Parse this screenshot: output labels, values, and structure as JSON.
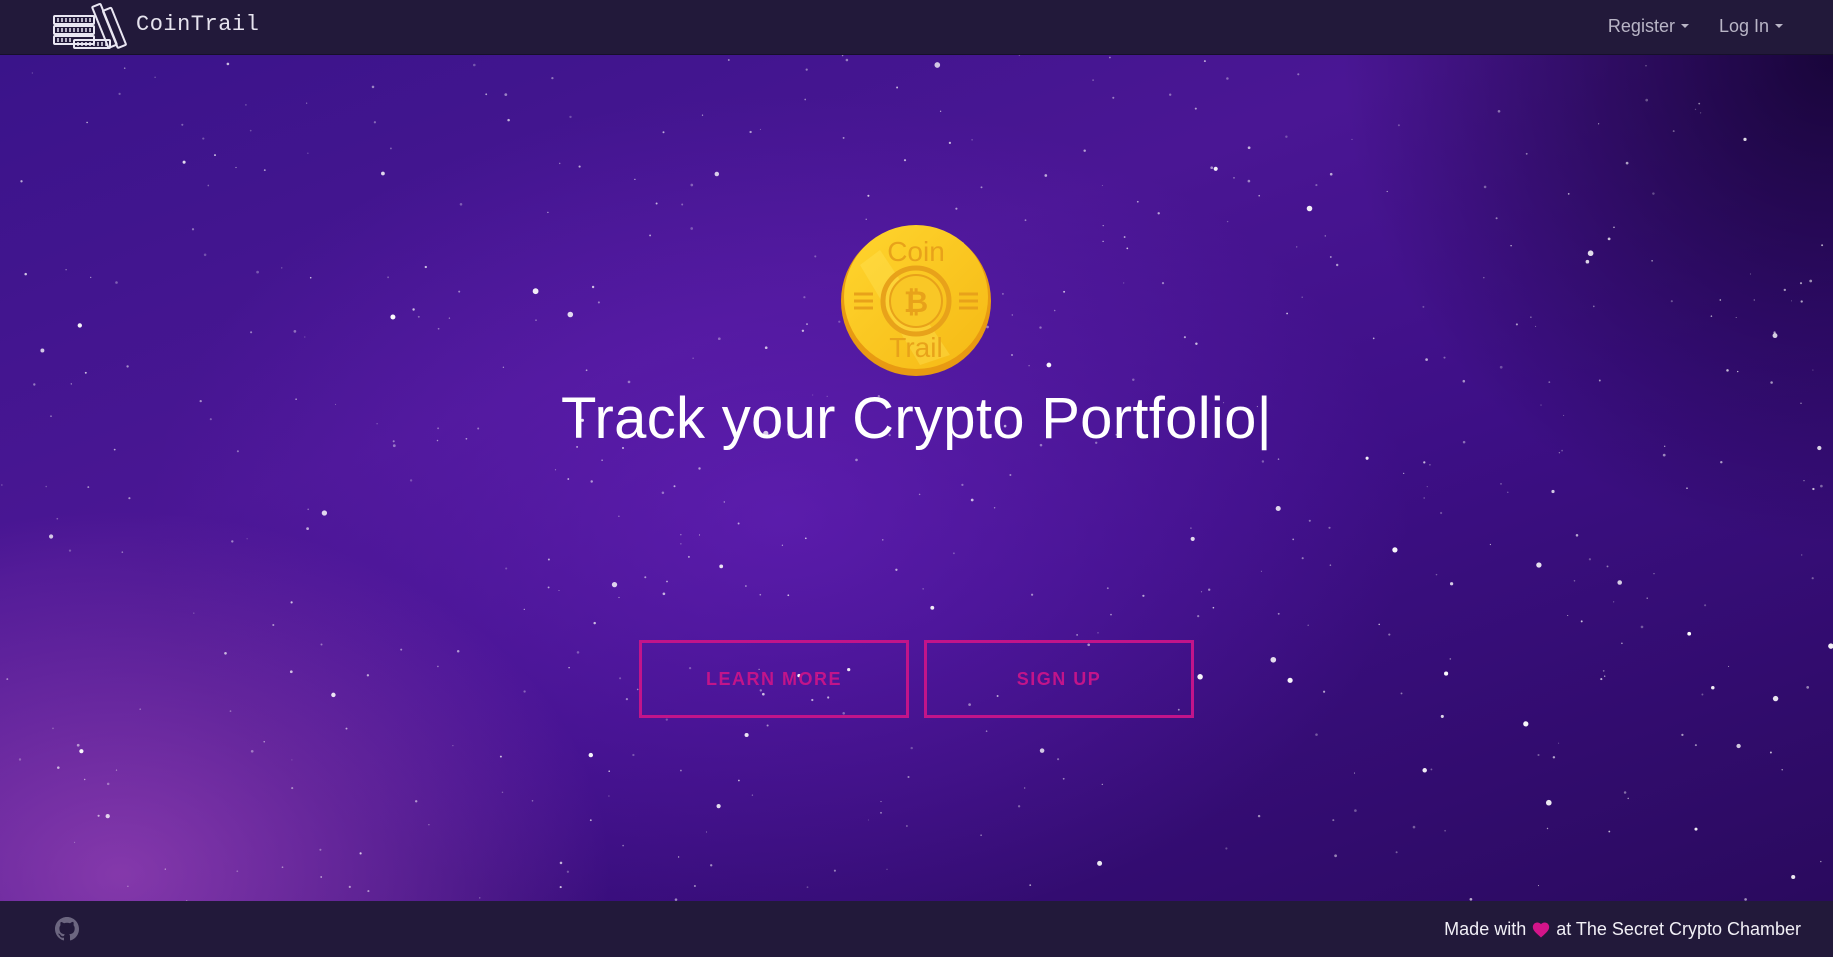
{
  "navbar": {
    "brand_name": "CoinTrail",
    "brand_icon": "coin-stack-icon",
    "register_label": "Register",
    "login_label": "Log In"
  },
  "hero": {
    "logo_top_text": "Coin",
    "logo_symbol": "₿",
    "logo_bottom_text": "Trail",
    "headline": "Track your Crypto Portfolio",
    "typing_cursor": "|",
    "learn_more_label": "LEARN MORE",
    "signup_label": "SIGN UP"
  },
  "footer": {
    "github_icon": "github-icon",
    "made_with_prefix": "Made with",
    "heart_icon": "heart-icon",
    "made_with_suffix": "at The Secret Crypto Chamber"
  },
  "colors": {
    "navbar_bg": "#22193a",
    "accent": "#c2148a",
    "coin_gold": "#f6c21a",
    "coin_text": "#e8a21a",
    "heart": "#d4148a"
  }
}
